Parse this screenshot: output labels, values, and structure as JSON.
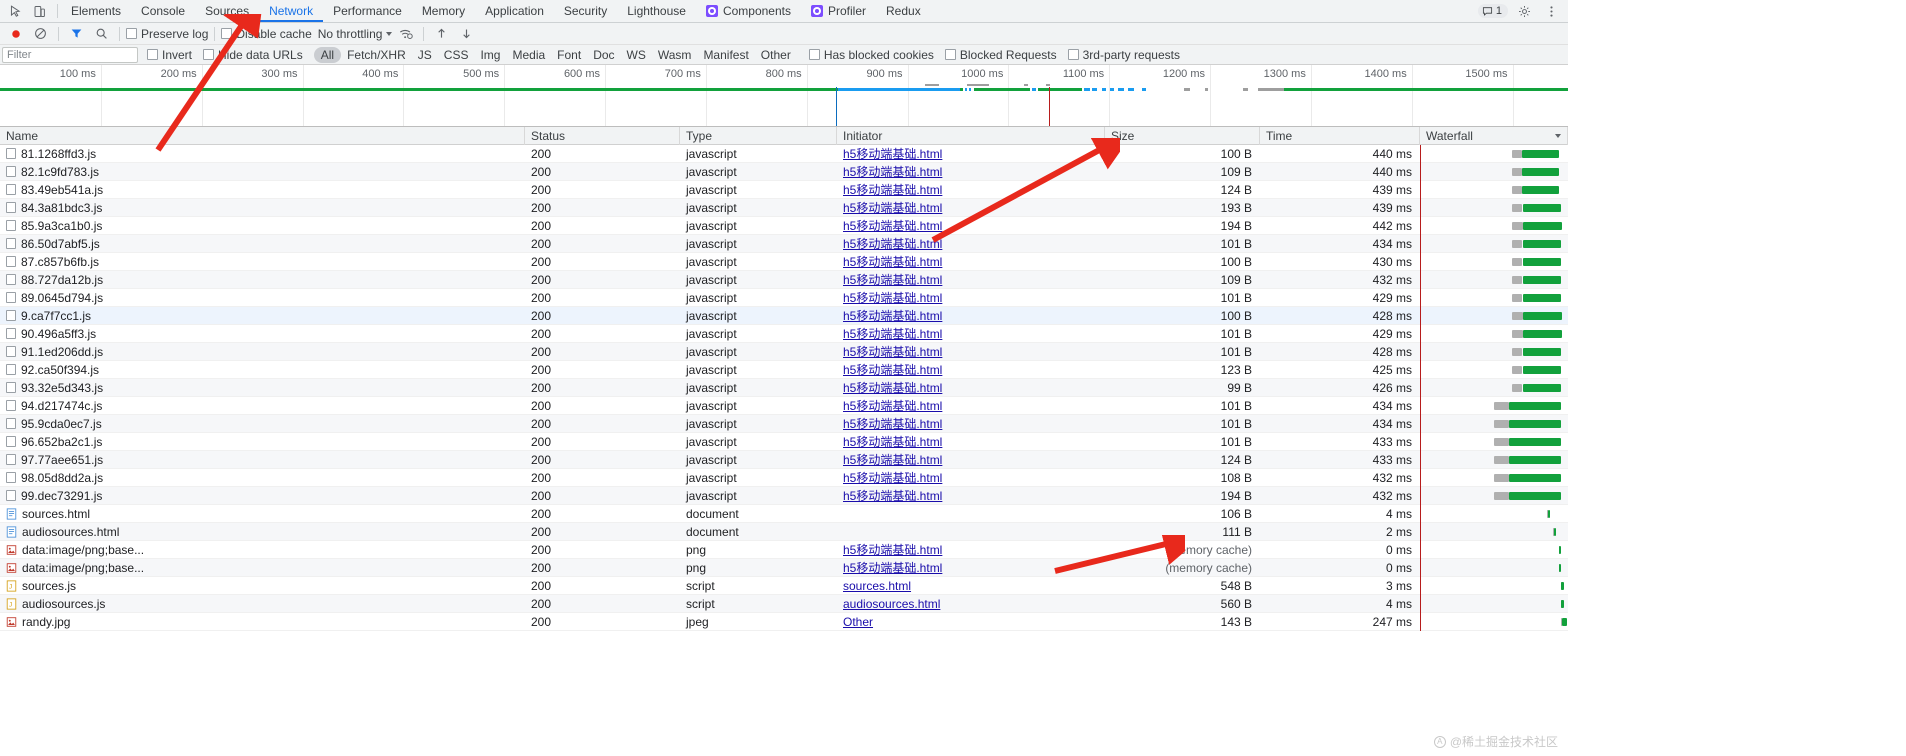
{
  "window": {
    "tabs": [
      {
        "label": "Elements",
        "selected": false,
        "icon": null
      },
      {
        "label": "Console",
        "selected": false,
        "icon": null
      },
      {
        "label": "Sources",
        "selected": false,
        "icon": null
      },
      {
        "label": "Network",
        "selected": true,
        "icon": null
      },
      {
        "label": "Performance",
        "selected": false,
        "icon": null
      },
      {
        "label": "Memory",
        "selected": false,
        "icon": null
      },
      {
        "label": "Application",
        "selected": false,
        "icon": null
      },
      {
        "label": "Security",
        "selected": false,
        "icon": null
      },
      {
        "label": "Lighthouse",
        "selected": false,
        "icon": null
      },
      {
        "label": "Components",
        "selected": false,
        "icon": "puzzle-icon"
      },
      {
        "label": "Profiler",
        "selected": false,
        "icon": "puzzle-icon"
      },
      {
        "label": "Redux",
        "selected": false,
        "icon": null
      }
    ],
    "message_count": "1",
    "accent": "#1a73e8"
  },
  "toolbar": {
    "record_title": "record-button",
    "clear_title": "clear-button",
    "filter_title": "filter-button",
    "search_title": "search-button",
    "preserve_log": "Preserve log",
    "disable_cache": "Disable cache",
    "throttling": "No throttling",
    "import_title": "import-har-button",
    "export_title": "export-har-button"
  },
  "filterbar": {
    "filter_placeholder": "Filter",
    "invert": "Invert",
    "hide_data_urls": "Hide data URLs",
    "types": [
      "All",
      "Fetch/XHR",
      "JS",
      "CSS",
      "Img",
      "Media",
      "Font",
      "Doc",
      "WS",
      "Wasm",
      "Manifest",
      "Other"
    ],
    "active_type": "All",
    "has_blocked_cookies": "Has blocked cookies",
    "blocked_requests": "Blocked Requests",
    "third_party_requests": "3rd-party requests"
  },
  "overview": {
    "ticks": [
      "100 ms",
      "200 ms",
      "300 ms",
      "400 ms",
      "500 ms",
      "600 ms",
      "700 ms",
      "800 ms",
      "900 ms",
      "1000 ms",
      "1100 ms",
      "1200 ms",
      "1300 ms",
      "1400 ms",
      "1500 ms"
    ],
    "dom_content_loaded_color": "#0b6cbe",
    "load_color": "#b71c1c",
    "green": "#12a13c",
    "blue": "#1a9cf0"
  },
  "table": {
    "columns": [
      "Name",
      "Status",
      "Type",
      "Initiator",
      "Size",
      "Time",
      "Waterfall"
    ],
    "rows": [
      {
        "name": "81.1268ffd3.js",
        "icon": "checkbox-icon",
        "status": "200",
        "type": "javascript",
        "initiator": "h5移动端基础.html",
        "size": "100 B",
        "time": "440 ms",
        "wf_start": 62,
        "wf_width": 32
      },
      {
        "name": "82.1c9fd783.js",
        "icon": "checkbox-icon",
        "status": "200",
        "type": "javascript",
        "initiator": "h5移动端基础.html",
        "size": "109 B",
        "time": "440 ms",
        "wf_start": 62,
        "wf_width": 32
      },
      {
        "name": "83.49eb541a.js",
        "icon": "checkbox-icon",
        "status": "200",
        "type": "javascript",
        "initiator": "h5移动端基础.html",
        "size": "124 B",
        "time": "439 ms",
        "wf_start": 62,
        "wf_width": 32
      },
      {
        "name": "84.3a81bdc3.js",
        "icon": "checkbox-icon",
        "status": "200",
        "type": "javascript",
        "initiator": "h5移动端基础.html",
        "size": "193 B",
        "time": "439 ms",
        "wf_start": 62,
        "wf_width": 33
      },
      {
        "name": "85.9a3ca1b0.js",
        "icon": "checkbox-icon",
        "status": "200",
        "type": "javascript",
        "initiator": "h5移动端基础.html",
        "size": "194 B",
        "time": "442 ms",
        "wf_start": 62,
        "wf_width": 34
      },
      {
        "name": "86.50d7abf5.js",
        "icon": "checkbox-icon",
        "status": "200",
        "type": "javascript",
        "initiator": "h5移动端基础.html",
        "size": "101 B",
        "time": "434 ms",
        "wf_start": 62,
        "wf_width": 33
      },
      {
        "name": "87.c857b6fb.js",
        "icon": "checkbox-icon",
        "status": "200",
        "type": "javascript",
        "initiator": "h5移动端基础.html",
        "size": "100 B",
        "time": "430 ms",
        "wf_start": 62,
        "wf_width": 33
      },
      {
        "name": "88.727da12b.js",
        "icon": "checkbox-icon",
        "status": "200",
        "type": "javascript",
        "initiator": "h5移动端基础.html",
        "size": "109 B",
        "time": "432 ms",
        "wf_start": 62,
        "wf_width": 33
      },
      {
        "name": "89.0645d794.js",
        "icon": "checkbox-icon",
        "status": "200",
        "type": "javascript",
        "initiator": "h5移动端基础.html",
        "size": "101 B",
        "time": "429 ms",
        "wf_start": 62,
        "wf_width": 33
      },
      {
        "name": "9.ca7f7cc1.js",
        "icon": "checkbox-icon",
        "status": "200",
        "type": "javascript",
        "initiator": "h5移动端基础.html",
        "size": "100 B",
        "time": "428 ms",
        "wf_start": 62,
        "wf_width": 34
      },
      {
        "name": "90.496a5ff3.js",
        "icon": "checkbox-icon",
        "status": "200",
        "type": "javascript",
        "initiator": "h5移动端基础.html",
        "size": "101 B",
        "time": "429 ms",
        "wf_start": 62,
        "wf_width": 34
      },
      {
        "name": "91.1ed206dd.js",
        "icon": "checkbox-icon",
        "status": "200",
        "type": "javascript",
        "initiator": "h5移动端基础.html",
        "size": "101 B",
        "time": "428 ms",
        "wf_start": 62,
        "wf_width": 33
      },
      {
        "name": "92.ca50f394.js",
        "icon": "checkbox-icon",
        "status": "200",
        "type": "javascript",
        "initiator": "h5移动端基础.html",
        "size": "123 B",
        "time": "425 ms",
        "wf_start": 62,
        "wf_width": 33
      },
      {
        "name": "93.32e5d343.js",
        "icon": "checkbox-icon",
        "status": "200",
        "type": "javascript",
        "initiator": "h5移动端基础.html",
        "size": "99 B",
        "time": "426 ms",
        "wf_start": 62,
        "wf_width": 33
      },
      {
        "name": "94.d217474c.js",
        "icon": "checkbox-icon",
        "status": "200",
        "type": "javascript",
        "initiator": "h5移动端基础.html",
        "size": "101 B",
        "time": "434 ms",
        "wf_start": 50,
        "wf_width": 45
      },
      {
        "name": "95.9cda0ec7.js",
        "icon": "checkbox-icon",
        "status": "200",
        "type": "javascript",
        "initiator": "h5移动端基础.html",
        "size": "101 B",
        "time": "434 ms",
        "wf_start": 50,
        "wf_width": 45
      },
      {
        "name": "96.652ba2c1.js",
        "icon": "checkbox-icon",
        "status": "200",
        "type": "javascript",
        "initiator": "h5移动端基础.html",
        "size": "101 B",
        "time": "433 ms",
        "wf_start": 50,
        "wf_width": 45
      },
      {
        "name": "97.77aee651.js",
        "icon": "checkbox-icon",
        "status": "200",
        "type": "javascript",
        "initiator": "h5移动端基础.html",
        "size": "124 B",
        "time": "433 ms",
        "wf_start": 50,
        "wf_width": 45
      },
      {
        "name": "98.05d8dd2a.js",
        "icon": "checkbox-icon",
        "status": "200",
        "type": "javascript",
        "initiator": "h5移动端基础.html",
        "size": "108 B",
        "time": "432 ms",
        "wf_start": 50,
        "wf_width": 45
      },
      {
        "name": "99.dec73291.js",
        "icon": "checkbox-icon",
        "status": "200",
        "type": "javascript",
        "initiator": "h5移动端基础.html",
        "size": "194 B",
        "time": "432 ms",
        "wf_start": 50,
        "wf_width": 45
      },
      {
        "name": "sources.html",
        "icon": "document-icon",
        "status": "200",
        "type": "document",
        "initiator": "",
        "size": "106 B",
        "time": "4 ms",
        "wf_start": 86,
        "wf_width": 2
      },
      {
        "name": "audiosources.html",
        "icon": "document-icon",
        "status": "200",
        "type": "document",
        "initiator": "",
        "size": "111 B",
        "time": "2 ms",
        "wf_start": 90,
        "wf_width": 2
      },
      {
        "name": "data:image/png;base...",
        "icon": "image-icon",
        "status": "200",
        "type": "png",
        "initiator": "h5移动端基础.html",
        "size": "(memory cache)",
        "time": "0 ms",
        "wf_start": 94,
        "wf_width": 1
      },
      {
        "name": "data:image/png;base...",
        "icon": "image-icon",
        "status": "200",
        "type": "png",
        "initiator": "h5移动端基础.html",
        "size": "(memory cache)",
        "time": "0 ms",
        "wf_start": 94,
        "wf_width": 1
      },
      {
        "name": "sources.js",
        "icon": "script-icon",
        "status": "200",
        "type": "script",
        "initiator": "sources.html",
        "size": "548 B",
        "time": "3 ms",
        "wf_start": 95,
        "wf_width": 2
      },
      {
        "name": "audiosources.js",
        "icon": "script-icon",
        "status": "200",
        "type": "script",
        "initiator": "audiosources.html",
        "size": "560 B",
        "time": "4 ms",
        "wf_start": 95,
        "wf_width": 2
      },
      {
        "name": "randy.jpg",
        "icon": "image-icon",
        "status": "200",
        "type": "jpeg",
        "initiator": "Other",
        "size": "143 B",
        "time": "247 ms",
        "wf_start": 95,
        "wf_width": 4
      }
    ]
  },
  "watermark": {
    "text": "@稀土掘金技术社区",
    "mark": "A"
  },
  "annotations": {
    "arrow_color": "#e8291c",
    "arrows": [
      "arrow-to-network-tab",
      "arrow-to-size-column",
      "arrow-to-memory-cache"
    ]
  }
}
